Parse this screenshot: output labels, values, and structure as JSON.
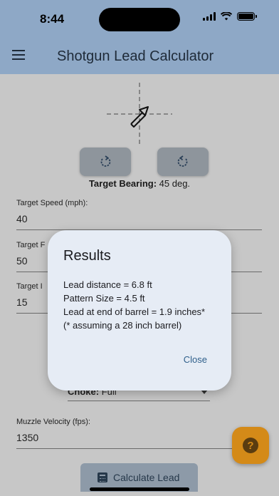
{
  "status_bar": {
    "time": "8:44"
  },
  "app_bar": {
    "title": "Shotgun Lead Calculator",
    "menu_icon": "hamburger-menu-icon"
  },
  "bearing": {
    "label": "Target Bearing:",
    "value": "45 deg."
  },
  "fields": {
    "target_speed": {
      "label": "Target Speed (mph):",
      "value": "40"
    },
    "target_distance": {
      "label": "Target F",
      "value": "50"
    },
    "target_height": {
      "label": "Target I",
      "value": "15"
    },
    "muzzle_velocity": {
      "label": "Muzzle Velocity (fps):",
      "value": "1350"
    }
  },
  "choke": {
    "label": "Choke:",
    "value": "Full"
  },
  "calculate_button": {
    "label": "Calculate Lead"
  },
  "help_button": {
    "glyph": "?"
  },
  "dialog": {
    "title": "Results",
    "lines": [
      "Lead distance = 6.8 ft",
      "Pattern Size = 4.5 ft",
      "Lead at end of barrel = 1.9 inches*",
      "(* assuming a 28 inch barrel)"
    ],
    "close_label": "Close"
  },
  "colors": {
    "app_bar": "#8ea8c6",
    "dialog_bg": "#e6ecf5",
    "fab": "#d48a18",
    "link": "#2f5f8a"
  }
}
